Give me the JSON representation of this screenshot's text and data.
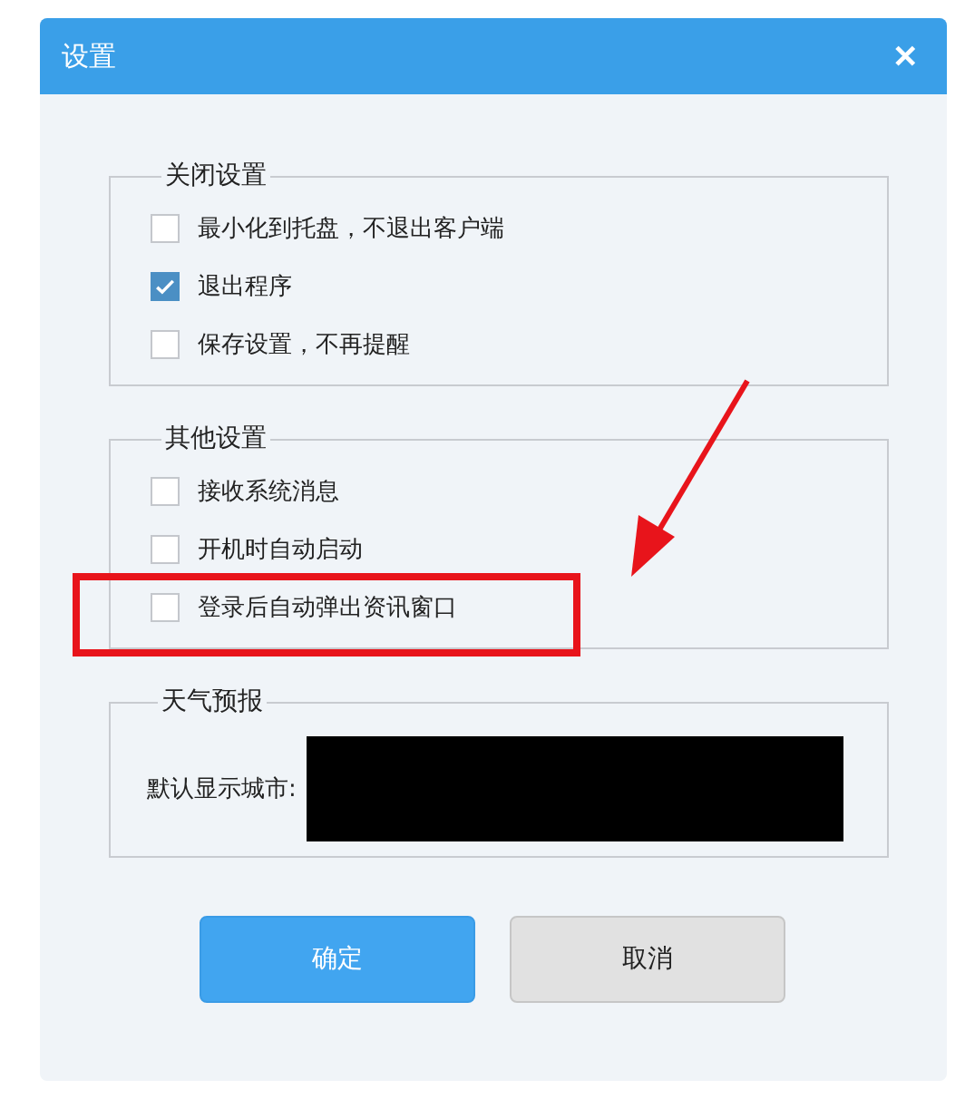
{
  "window": {
    "title": "设置",
    "close": "✕"
  },
  "groups": [
    {
      "title": "关闭设置",
      "options": [
        {
          "label": "最小化到托盘，不退出客户端",
          "checked": false
        },
        {
          "label": "退出程序",
          "checked": true
        },
        {
          "label": "保存设置，不再提醒",
          "checked": false
        }
      ]
    },
    {
      "title": "其他设置",
      "options": [
        {
          "label": "接收系统消息",
          "checked": false
        },
        {
          "label": "开机时自动启动",
          "checked": false
        },
        {
          "label": "登录后自动弹出资讯窗口",
          "checked": false
        }
      ]
    }
  ],
  "weather": {
    "title": "天气预报",
    "label": "默认显示城市:"
  },
  "buttons": [
    {
      "label": "确定",
      "kind": "primary"
    },
    {
      "label": "取消",
      "kind": "secondary"
    }
  ]
}
